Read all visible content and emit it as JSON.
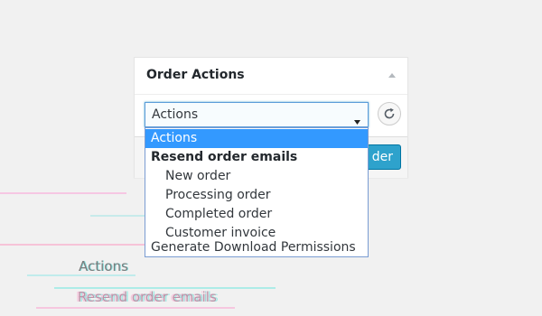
{
  "panel": {
    "title": "Order Actions",
    "collapse_icon": "triangle-up-icon",
    "select_value": "Actions",
    "refresh_icon": "refresh-icon",
    "save_label": "der"
  },
  "dropdown": {
    "selected": "Actions",
    "group_label": "Resend order emails",
    "group_options": [
      "New order",
      "Processing order",
      "Completed order",
      "Customer invoice"
    ],
    "extra_option": "Generate Download Permissions"
  },
  "artifacts": {
    "actions_text": "Actions",
    "resend_text": "Resend order emails"
  },
  "colors": {
    "accent": "#3399ff",
    "button": "#2ea2cc",
    "background": "#f1f1f1"
  }
}
